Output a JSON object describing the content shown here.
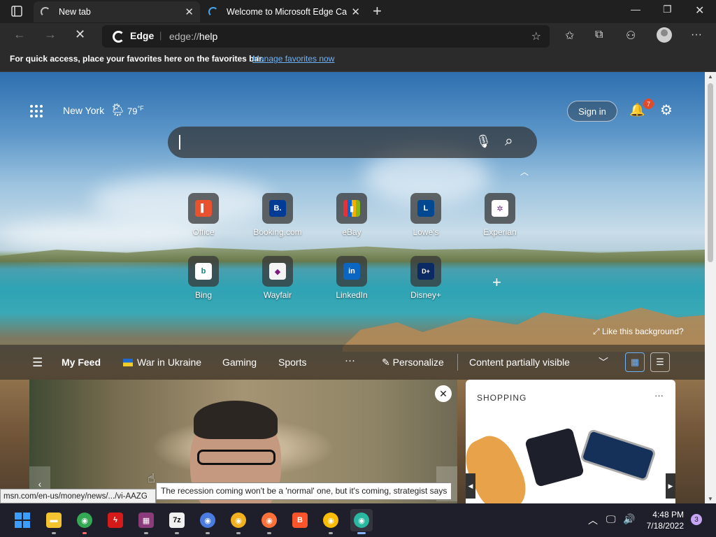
{
  "tabs": [
    {
      "title": "New tab",
      "active": true
    },
    {
      "title": "Welcome to Microsoft Edge Can",
      "active": false
    }
  ],
  "address": {
    "brand": "Edge",
    "url_prefix": "edge://",
    "url_path": "help"
  },
  "favorites_bar": {
    "message": "For quick access, place your favorites here on the favorites bar.",
    "link": "Manage favorites now"
  },
  "header": {
    "city": "New York",
    "temperature": "79",
    "unit": "°F",
    "sign_in": "Sign in",
    "notification_count": "7"
  },
  "quick_links": [
    {
      "label": "Office",
      "glyph": "▌",
      "color": "#e9522f"
    },
    {
      "label": "Booking.com",
      "glyph": "B.",
      "color": "#003b95"
    },
    {
      "label": "eBay",
      "glyph": "▮",
      "color": "#e53238"
    },
    {
      "label": "Lowe's",
      "glyph": "L",
      "color": "#004990"
    },
    {
      "label": "Experian",
      "glyph": "✲",
      "color": "#ffffff"
    },
    {
      "label": "Bing",
      "glyph": "b",
      "color": "#ffffff"
    },
    {
      "label": "Wayfair",
      "glyph": "◆",
      "color": "#7f187f"
    },
    {
      "label": "LinkedIn",
      "glyph": "in",
      "color": "#0a66c2"
    },
    {
      "label": "Disney+",
      "glyph": "D+",
      "color": "#0b2a63"
    }
  ],
  "like_background": "Like this background?",
  "feed_nav": {
    "items": [
      "My Feed",
      "War in Ukraine",
      "Gaming",
      "Sports"
    ],
    "more": "···",
    "personalize": "Personalize",
    "content_visibility": "Content partially visible"
  },
  "shopping_card": {
    "title": "SHOPPING",
    "menu": "···"
  },
  "tooltip": "The recession coming won't be a 'normal' one, but it's coming, strategist says",
  "status_url": "msn.com/en-us/money/news/.../vi-AAZG",
  "taskbar": {
    "apps": [
      {
        "name": "file-explorer",
        "glyph": "▬",
        "color": "#f4c430"
      },
      {
        "name": "chrome",
        "glyph": "◉",
        "color": "#34a853"
      },
      {
        "name": "avira",
        "glyph": "ϟ",
        "color": "#d61a1a"
      },
      {
        "name": "winrar",
        "glyph": "▦",
        "color": "#8b3a7a"
      },
      {
        "name": "7zip",
        "glyph": "7z",
        "color": "#222222"
      },
      {
        "name": "chromium",
        "glyph": "◉",
        "color": "#4a7be0"
      },
      {
        "name": "chrome-canary",
        "glyph": "◉",
        "color": "#f2b01e"
      },
      {
        "name": "firefox",
        "glyph": "◉",
        "color": "#ff7139"
      },
      {
        "name": "brave",
        "glyph": "B",
        "color": "#fb542b"
      },
      {
        "name": "chrome-beta",
        "glyph": "◉",
        "color": "#fbbc04"
      },
      {
        "name": "edge-canary",
        "glyph": "◉",
        "color": "#2bb8a0"
      }
    ],
    "time": "4:48 PM",
    "date": "7/18/2022",
    "notification_count": "3"
  }
}
